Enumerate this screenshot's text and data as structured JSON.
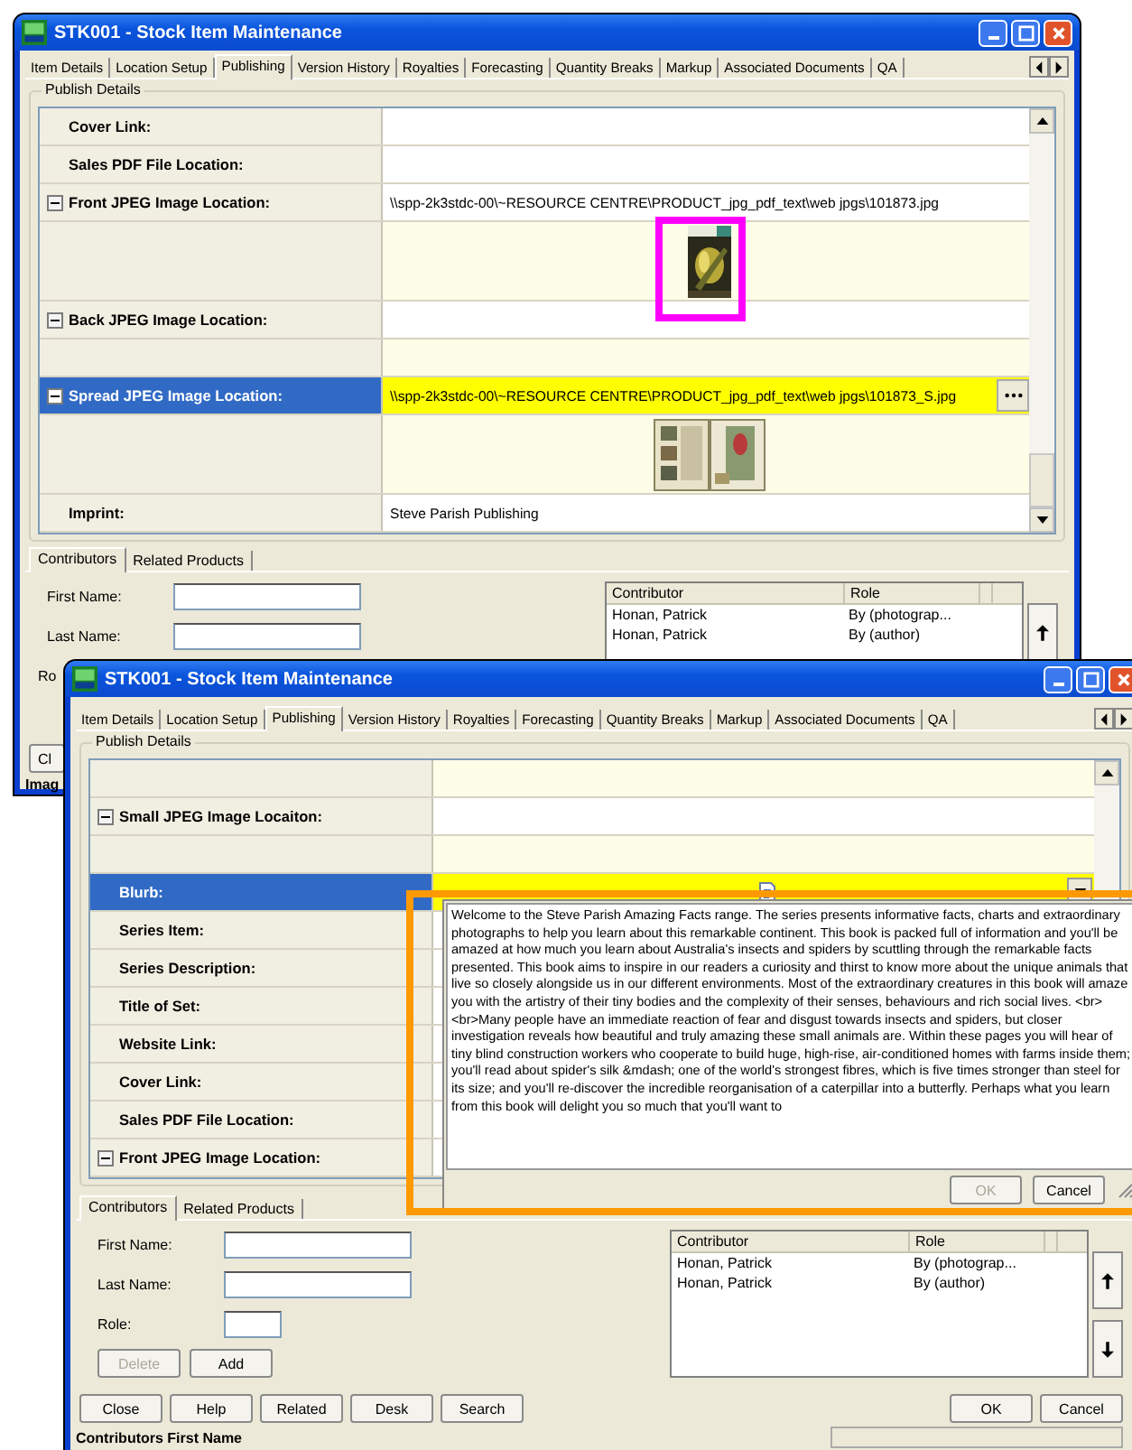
{
  "windows": [
    {
      "title": "STK001 - Stock Item Maintenance",
      "tabs": [
        {
          "label": "Item Details",
          "selected": false
        },
        {
          "label": "Location Setup",
          "selected": false
        },
        {
          "label": "Publishing",
          "selected": true
        },
        {
          "label": "Version History",
          "selected": false
        },
        {
          "label": "Royalties",
          "selected": false
        },
        {
          "label": "Forecasting",
          "selected": false
        },
        {
          "label": "Quantity Breaks",
          "selected": false
        },
        {
          "label": "Markup",
          "selected": false
        },
        {
          "label": "Associated Documents",
          "selected": false
        },
        {
          "label": "QA",
          "selected": false
        }
      ],
      "group_title": "Publish Details",
      "grid": [
        {
          "kind": "field",
          "label": "Cover Link:",
          "selected": false
        },
        {
          "kind": "field",
          "label": "Sales PDF File Location:",
          "selected": false
        },
        {
          "kind": "image_field",
          "label": "Front JPEG Image Location:",
          "value": "\\\\spp-2k3stdc-00\\~RESOURCE CENTRE\\PRODUCT_jpg_pdf_text\\web jpgs\\101873.jpg",
          "expanded": true,
          "selected": false
        },
        {
          "kind": "preview",
          "selected": false
        },
        {
          "kind": "image_field",
          "label": "Back JPEG Image Location:",
          "expanded": true,
          "selected": false
        },
        {
          "kind": "blank",
          "selected": false
        },
        {
          "kind": "image_field",
          "label": "Spread JPEG Image Location:",
          "value": "\\\\spp-2k3stdc-00\\~RESOURCE CENTRE\\PRODUCT_jpg_pdf_text\\web jpgs\\101873_S.jpg",
          "expanded": true,
          "selected": true
        },
        {
          "kind": "preview",
          "selected": false
        },
        {
          "kind": "field",
          "label": "Imprint:",
          "value": "Steve Parish Publishing",
          "selected": false
        }
      ],
      "bottom_tabs": [
        {
          "label": "Contributors",
          "selected": true
        },
        {
          "label": "Related Products",
          "selected": false
        }
      ],
      "form_fields": [
        {
          "kind": "text",
          "label": "First Name:"
        },
        {
          "kind": "text",
          "label": "Last Name:"
        },
        {
          "kind": "label_only",
          "label": "Ro"
        }
      ],
      "contributors": {
        "columns": [
          "Contributor",
          "Role"
        ],
        "rows": [
          [
            "Honan, Patrick",
            "By (photograp..."
          ],
          [
            "Honan, Patrick",
            "By (author)"
          ]
        ]
      },
      "move_buttons": [
        {
          "kind": "up"
        }
      ],
      "left_buttons": [
        {
          "label": "Cl",
          "disabled": false
        }
      ],
      "status": "Imag",
      "highlight": {
        "color": "#ff00ff"
      }
    },
    {
      "title": "STK001 - Stock Item Maintenance",
      "tabs": [
        {
          "label": "Item Details",
          "selected": false
        },
        {
          "label": "Location Setup",
          "selected": false
        },
        {
          "label": "Publishing",
          "selected": true
        },
        {
          "label": "Version History",
          "selected": false
        },
        {
          "label": "Royalties",
          "selected": false
        },
        {
          "label": "Forecasting",
          "selected": false
        },
        {
          "label": "Quantity Breaks",
          "selected": false
        },
        {
          "label": "Markup",
          "selected": false
        },
        {
          "label": "Associated Documents",
          "selected": false
        },
        {
          "label": "QA",
          "selected": false
        }
      ],
      "group_title": "Publish Details",
      "grid": [
        {
          "kind": "blank",
          "selected": false
        },
        {
          "kind": "image_field",
          "label": "Small JPEG Image Locaiton:",
          "expanded": true,
          "selected": false
        },
        {
          "kind": "blank",
          "selected": false
        },
        {
          "kind": "memo",
          "label": "Blurb:",
          "selected": true
        },
        {
          "kind": "field",
          "label": "Series Item:",
          "selected": false
        },
        {
          "kind": "field",
          "label": "Series Description:",
          "selected": false
        },
        {
          "kind": "field",
          "label": "Title of Set:",
          "selected": false
        },
        {
          "kind": "field",
          "label": "Website Link:",
          "selected": false
        },
        {
          "kind": "field",
          "label": "Cover Link:",
          "selected": false
        },
        {
          "kind": "field",
          "label": "Sales PDF File Location:",
          "selected": false
        },
        {
          "kind": "image_field",
          "label": "Front JPEG Image Location:",
          "expanded": true,
          "selected": false
        }
      ],
      "popup": {
        "text": "Welcome to the Steve Parish Amazing Facts range. The series presents informative facts, charts and extraordinary photographs to help you learn about this remarkable continent.  This book is packed full of information and you'll be amazed at how much you learn about Australia's insects and spiders by scuttling through the remarkable facts presented. This book aims to inspire in our readers a curiosity and thirst to know more about the unique animals that live so closely alongside us in our different environments. Most of the extraordinary creatures in this book will amaze you with the artistry of their tiny bodies and the complexity of their senses, behaviours and rich social lives.  <br> <br>Many people have an immediate reaction of fear and disgust towards insects and spiders, but closer investigation reveals how beautiful and truly amazing these small animals are. Within these pages you will hear of tiny blind construction workers who cooperate to build huge, high-rise, air-conditioned homes with farms inside them; you'll read about spider's silk &mdash; one of the world's strongest fibres, which is five times stronger than steel for its size; and you'll re-discover the incredible reorganisation of a caterpillar into a butterfly. Perhaps what you learn from this book will delight you so much that you'll want to",
        "buttons": [
          {
            "label": "OK",
            "disabled": true
          },
          {
            "label": "Cancel",
            "disabled": false
          }
        ]
      },
      "bottom_tabs": [
        {
          "label": "Contributors",
          "selected": true
        },
        {
          "label": "Related Products",
          "selected": false
        }
      ],
      "form_fields": [
        {
          "kind": "text",
          "label": "First Name:"
        },
        {
          "kind": "text",
          "label": "Last Name:"
        },
        {
          "kind": "short",
          "label": "Role:"
        }
      ],
      "form_buttons": [
        {
          "label": "Delete",
          "disabled": true
        },
        {
          "label": "Add",
          "disabled": false
        }
      ],
      "contributors": {
        "columns": [
          "Contributor",
          "Role"
        ],
        "rows": [
          [
            "Honan, Patrick",
            "By (photograp..."
          ],
          [
            "Honan, Patrick",
            "By (author)"
          ]
        ]
      },
      "move_buttons": [
        {
          "kind": "up"
        },
        {
          "kind": "down"
        }
      ],
      "left_buttons": [
        {
          "label": "Close",
          "disabled": false
        },
        {
          "label": "Help",
          "disabled": false
        },
        {
          "label": "Related",
          "disabled": false
        },
        {
          "label": "Desk",
          "disabled": false
        },
        {
          "label": "Search",
          "disabled": false
        }
      ],
      "right_buttons": [
        {
          "label": "OK",
          "disabled": false
        },
        {
          "label": "Cancel",
          "disabled": false
        }
      ],
      "status": "Contributors First Name",
      "highlight": {
        "color": "#ff9900"
      }
    }
  ]
}
